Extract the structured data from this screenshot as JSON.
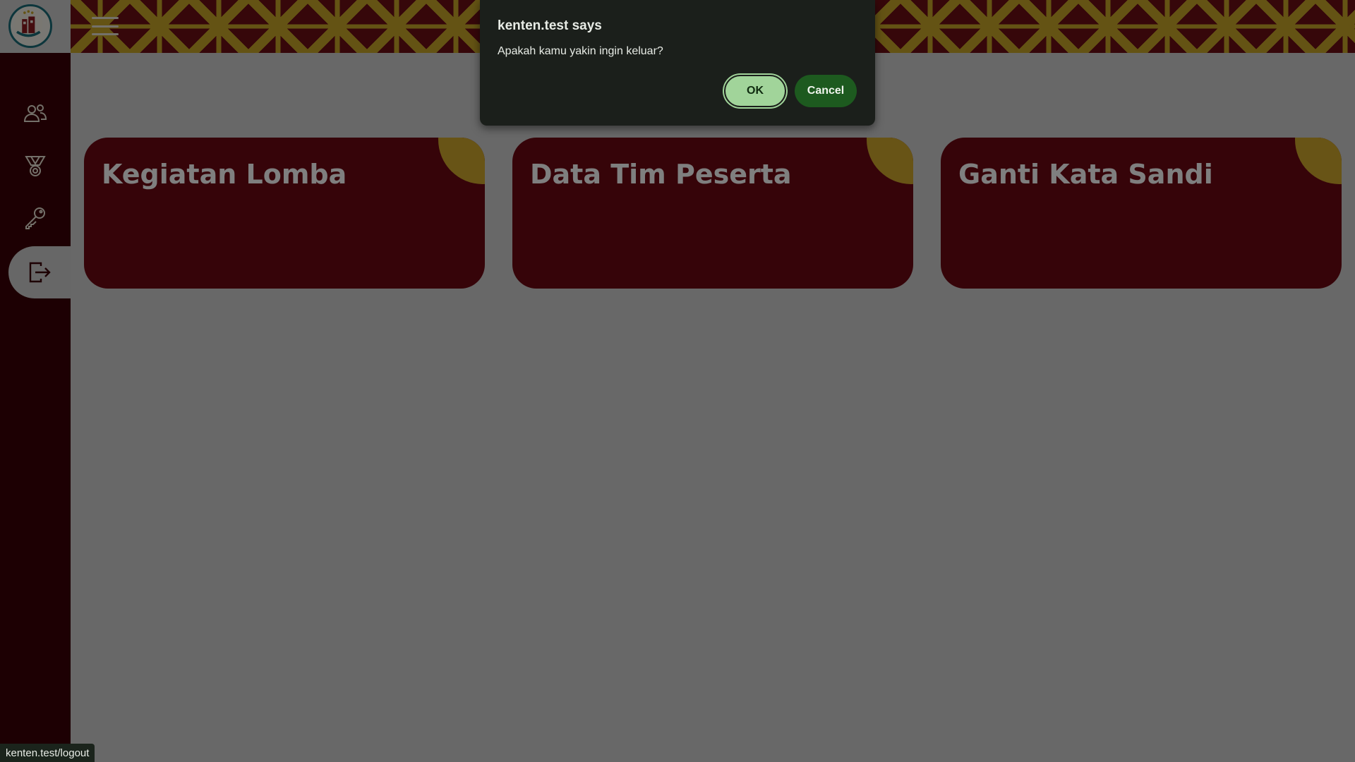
{
  "header": {
    "menu_icon": "hamburger-icon"
  },
  "sidebar": {
    "logo": "emblem-logo",
    "items": [
      {
        "icon": "users-icon"
      },
      {
        "icon": "medal-icon"
      },
      {
        "icon": "key-icon"
      },
      {
        "icon": "logout-icon",
        "active": true
      }
    ]
  },
  "cards": [
    {
      "title": "Kegiatan Lomba"
    },
    {
      "title": "Data Tim Peserta"
    },
    {
      "title": "Ganti Kata Sandi"
    }
  ],
  "dialog": {
    "title": "kenten.test says",
    "message": "Apakah kamu yakin ingin keluar?",
    "ok_label": "OK",
    "cancel_label": "Cancel"
  },
  "status_bar": {
    "url": "kenten.test/logout"
  },
  "colors": {
    "sidebar": "#3a0006",
    "card": "#6c0912",
    "accent_gold": "#d1a82d",
    "ok_button": "#a1d49a",
    "cancel_button": "#1d5a1f",
    "dialog_bg": "#1b1f1b"
  }
}
